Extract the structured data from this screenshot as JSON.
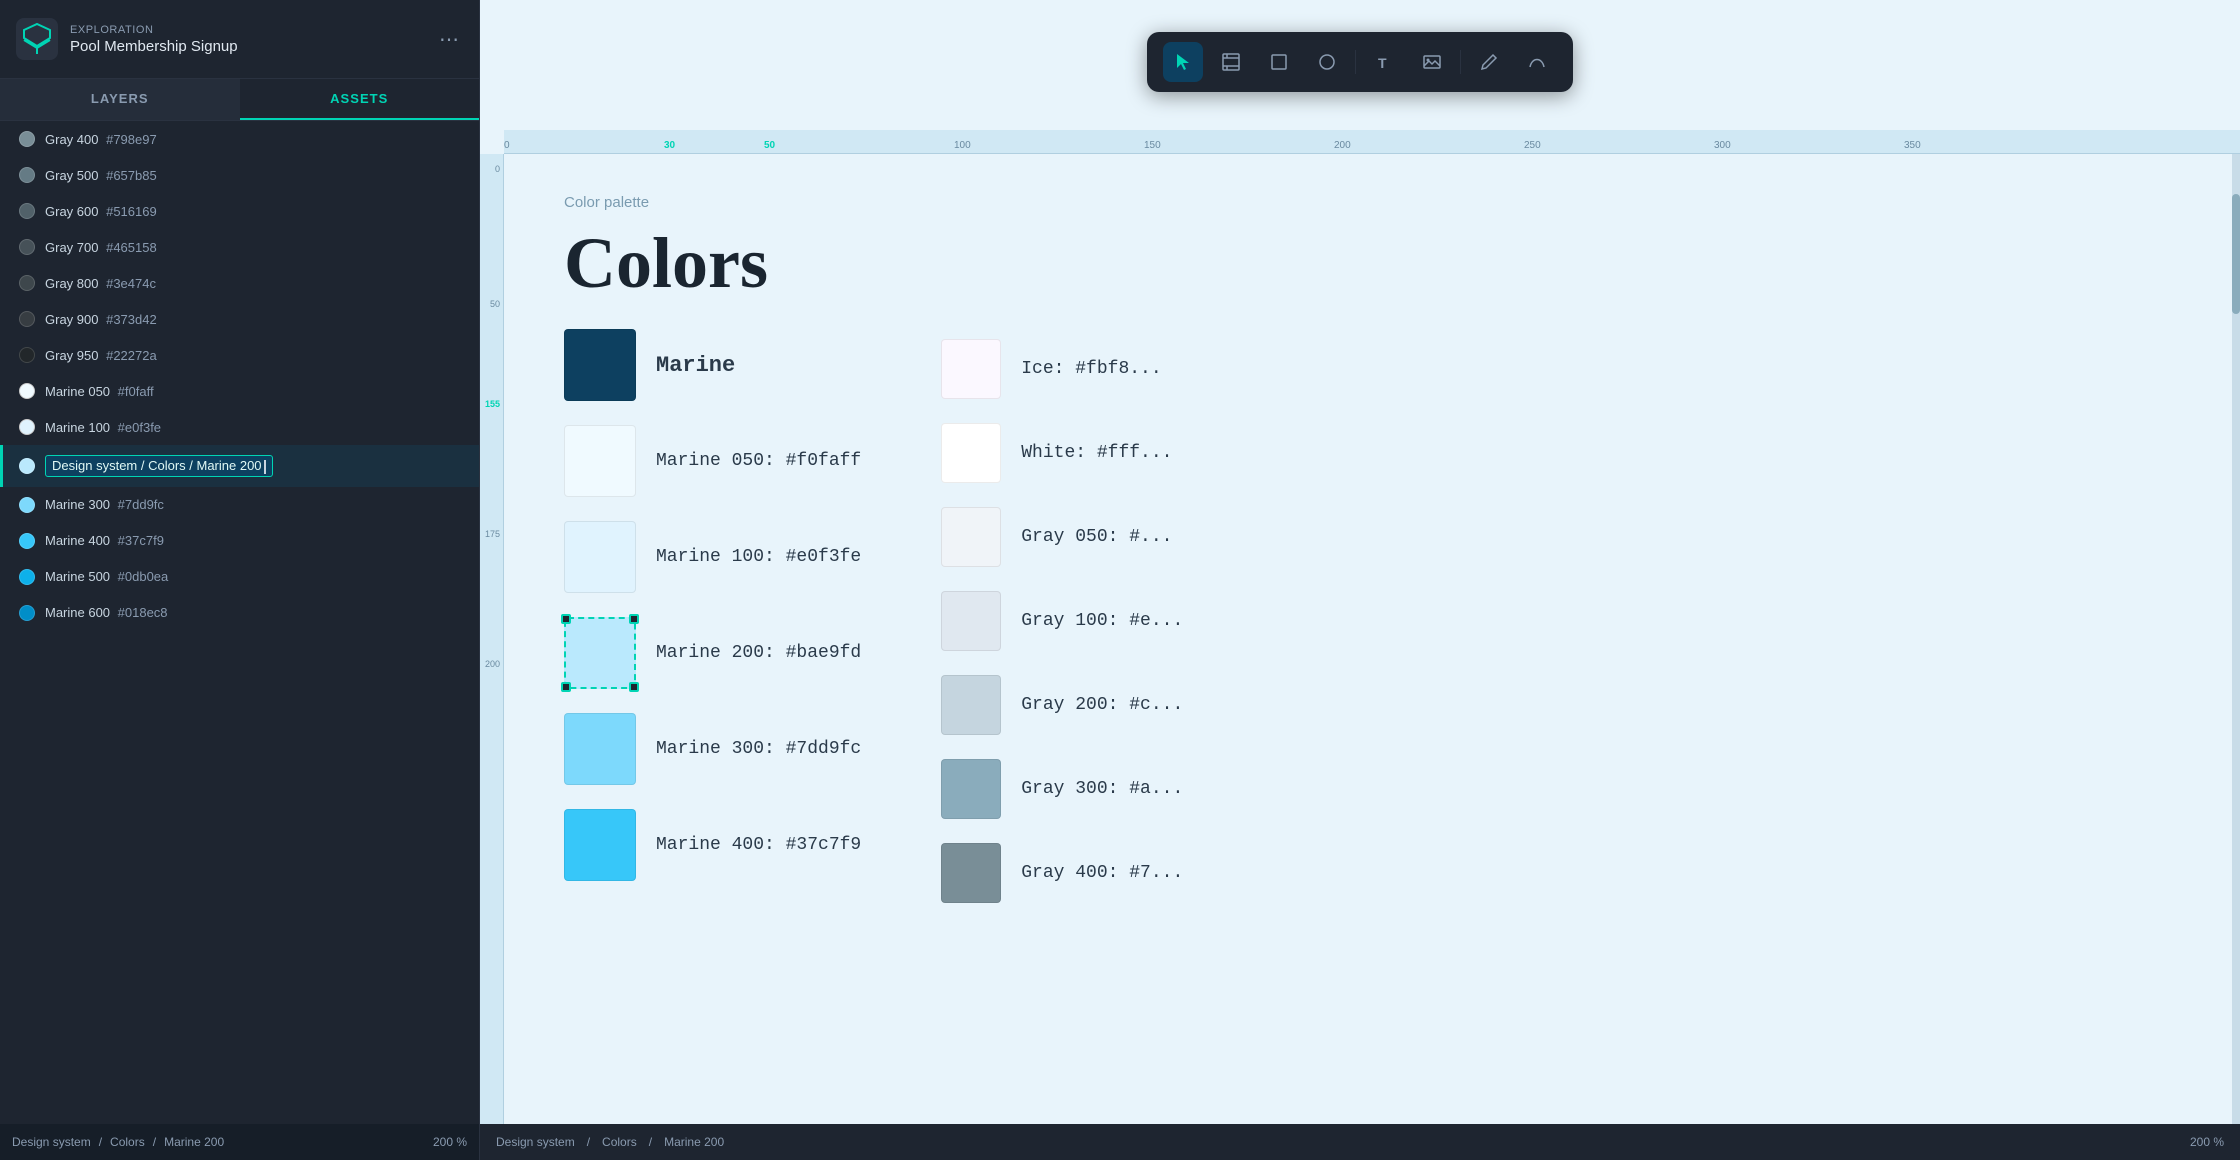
{
  "app": {
    "label": "EXPLORATION",
    "title": "Pool Membership Signup",
    "more_icon": "⋯"
  },
  "tabs": {
    "layers_label": "LAYERS",
    "assets_label": "ASSETS"
  },
  "layers": [
    {
      "name": "Gray 400",
      "hex": "#798e97",
      "color": "#798e97"
    },
    {
      "name": "Gray 500",
      "hex": "#657b85",
      "color": "#657b85"
    },
    {
      "name": "Gray 600",
      "hex": "#516169",
      "color": "#516169"
    },
    {
      "name": "Gray 700",
      "hex": "#465158",
      "color": "#465158"
    },
    {
      "name": "Gray 800",
      "hex": "#3e474c",
      "color": "#3e474c"
    },
    {
      "name": "Gray 900",
      "hex": "#373d42",
      "color": "#373d42"
    },
    {
      "name": "Gray 950",
      "hex": "#22272a",
      "color": "#22272a"
    },
    {
      "name": "Marine 050",
      "hex": "#f0faff",
      "color": "#f0faff"
    },
    {
      "name": "Marine 100",
      "hex": "#e0f3fe",
      "color": "#e0f3fe"
    },
    {
      "name": "Design system / Colors / Marine 200",
      "hex": "",
      "color": "#bae9fd",
      "selected": true
    },
    {
      "name": "Marine 300",
      "hex": "#7dd9fc",
      "color": "#7dd9fc"
    },
    {
      "name": "Marine 400",
      "hex": "#37c7f9",
      "color": "#37c7f9"
    },
    {
      "name": "Marine 500",
      "hex": "#0db0ea",
      "color": "#0db0ea"
    },
    {
      "name": "Marine 600",
      "hex": "#018ec8",
      "color": "#018ec8"
    }
  ],
  "canvas": {
    "breadcrumb": "Color palette",
    "heading": "Colors",
    "color_items": [
      {
        "label": "Marine",
        "color": "#0d4060",
        "id": "marine-base"
      },
      {
        "label": "Marine 050:  #f0faff",
        "color": "#f0faff",
        "id": "marine-050"
      },
      {
        "label": "Marine 100:  #e0f3fe",
        "color": "#e0f3fe",
        "id": "marine-100"
      },
      {
        "label": "Marine 200:  #bae9fd",
        "color": "#bae9fd",
        "id": "marine-200",
        "selected": true
      },
      {
        "label": "Marine 300:  #7dd9fc",
        "color": "#7dd9fc",
        "id": "marine-300"
      },
      {
        "label": "Marine 400:  #37c7f9",
        "color": "#37c7f9",
        "id": "marine-400"
      }
    ],
    "right_items": [
      {
        "label": "Ice:   #fbf8...",
        "color": "#fbf8ff",
        "id": "ice"
      },
      {
        "label": "White: #fff...",
        "color": "#ffffff",
        "id": "white"
      },
      {
        "label": "Gray 050:  #...",
        "color": "#f0f4f8",
        "id": "gray-050"
      },
      {
        "label": "Gray 100:  #e...",
        "color": "#e0e8f0",
        "id": "gray-100"
      },
      {
        "label": "Gray 200:  #c...",
        "color": "#c0ccd8",
        "id": "gray-200"
      },
      {
        "label": "Gray 300:  #a...",
        "color": "#a0b0c0",
        "id": "gray-300"
      },
      {
        "label": "Gray 400:  #7...",
        "color": "#798e97",
        "id": "gray-400"
      }
    ]
  },
  "toolbar": {
    "tools": [
      {
        "id": "select",
        "icon": "▷",
        "active": true
      },
      {
        "id": "frame",
        "icon": "⊡",
        "active": false
      },
      {
        "id": "rect",
        "icon": "□",
        "active": false
      },
      {
        "id": "circle",
        "icon": "○",
        "active": false
      },
      {
        "id": "text",
        "icon": "T",
        "active": false
      },
      {
        "id": "image",
        "icon": "⊞",
        "active": false
      },
      {
        "id": "pen",
        "icon": "✎",
        "active": false
      },
      {
        "id": "path",
        "icon": "∿",
        "active": false
      }
    ]
  },
  "ruler": {
    "marks": [
      {
        "value": "0",
        "pos": 0,
        "highlight": false
      },
      {
        "value": "30",
        "pos": 160,
        "highlight": true
      },
      {
        "value": "50",
        "pos": 265,
        "highlight": true
      },
      {
        "value": "100",
        "pos": 450,
        "highlight": false
      },
      {
        "value": "150",
        "pos": 630,
        "highlight": false
      },
      {
        "value": "200",
        "pos": 810,
        "highlight": false
      },
      {
        "value": "250",
        "pos": 990,
        "highlight": false
      },
      {
        "value": "300",
        "pos": 1170,
        "highlight": false
      },
      {
        "value": "350",
        "pos": 1350,
        "highlight": false
      }
    ]
  },
  "status": {
    "design_system": "Design system",
    "slash": "/",
    "colors": "Colors",
    "slash2": "/",
    "marine": "Marine 200",
    "percent": "200 %"
  }
}
